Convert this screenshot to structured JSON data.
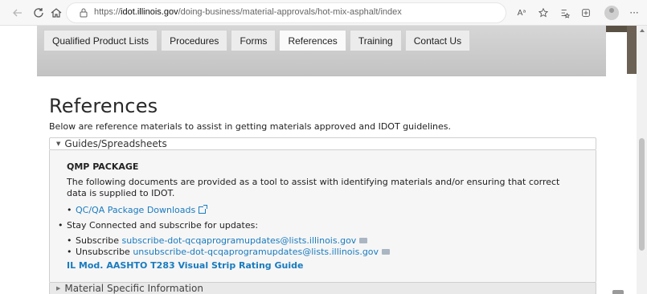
{
  "browser": {
    "url_prefix": "https://",
    "url_host": "idot.illinois.gov",
    "url_path": "/doing-business/material-approvals/hot-mix-asphalt/index",
    "read_aloud_label": "Aᵃ",
    "more_label": "···"
  },
  "tabs": [
    {
      "label": "Qualified Product Lists"
    },
    {
      "label": "Procedures"
    },
    {
      "label": "Forms"
    },
    {
      "label": "References",
      "active": true
    },
    {
      "label": "Training"
    },
    {
      "label": "Contact Us"
    }
  ],
  "page": {
    "title": "References",
    "intro": "Below are reference materials to assist in getting materials approved and IDOT guidelines."
  },
  "accordion1": {
    "title": "Guides/Spreadsheets",
    "heading": "QMP PACKAGE",
    "paragraph": "The following documents are provided as a tool to assist with identifying materials and/or ensuring that correct data is supplied to IDOT.",
    "download_link": "QC/QA Package Downloads",
    "stay_connected": "Stay Connected and subscribe for updates:",
    "subscribe_label": "Subscribe",
    "subscribe_email": "subscribe-dot-qcqaprogramupdates@lists.illinois.gov",
    "unsubscribe_label": "Unsubscribe",
    "unsubscribe_email": "unsubscribe-dot-qcqaprogramupdates@lists.illinois.gov",
    "guide_link": "IL Mod. AASHTO T283 Visual Strip Rating Guide"
  },
  "accordion2": {
    "title": "Material Specific Information"
  },
  "colors": {
    "link": "#1a7bbf",
    "band": "#c9c9c9"
  }
}
